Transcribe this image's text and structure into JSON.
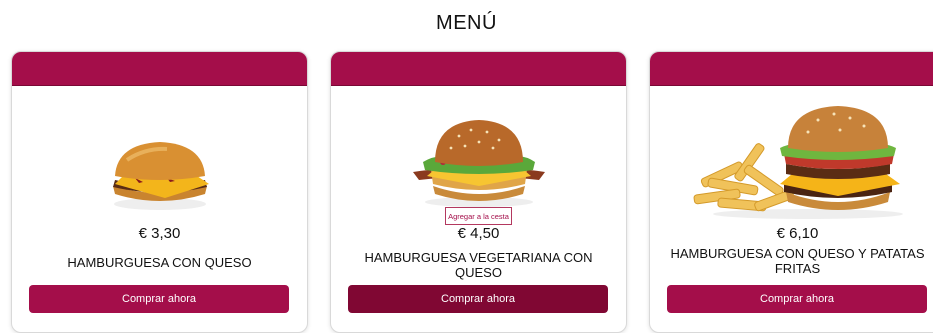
{
  "page": {
    "title": "MENÚ"
  },
  "colors": {
    "accent": "#a40e4a",
    "accent_dark": "#800733"
  },
  "products": [
    {
      "price": "€ 3,30",
      "name": "HAMBURGUESA CON QUESO",
      "buy_label": "Comprar ahora",
      "image": "cheeseburger-image"
    },
    {
      "price": "€ 4,50",
      "name": "HAMBURGUESA VEGETARIANA CON QUESO",
      "buy_label": "Comprar ahora",
      "add_to_basket_label": "Agregar a la cesta",
      "image": "veggie-burger-image"
    },
    {
      "price": "€ 6,10",
      "name": "HAMBURGUESA CON QUESO Y PATATAS FRITAS",
      "buy_label": "Comprar ahora",
      "image": "burger-fries-image"
    }
  ]
}
